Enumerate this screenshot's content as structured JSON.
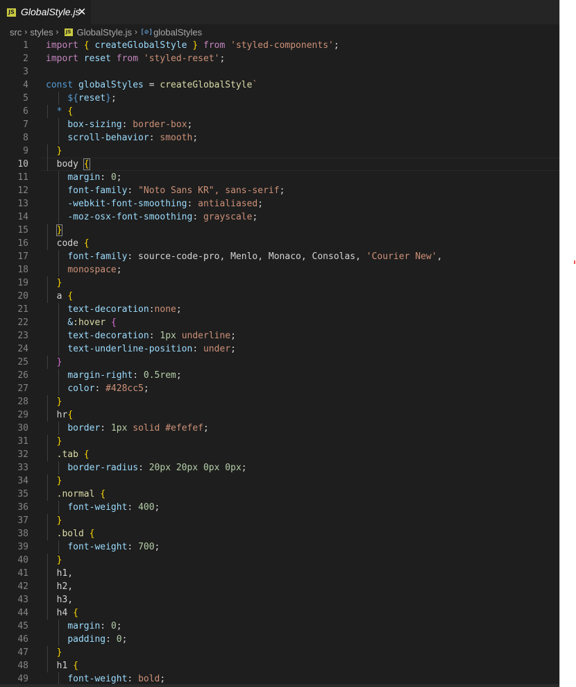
{
  "tab": {
    "title": "GlobalStyle.js",
    "close_glyph": "✕",
    "icon_label": "JS"
  },
  "breadcrumb": {
    "items": [
      "src",
      "styles",
      "GlobalStyle.js",
      "globalStyles"
    ],
    "separator": "›",
    "file_icon_label": "JS",
    "symbol_icon": "[⊘]"
  },
  "editor": {
    "active_line": 10,
    "lines": [
      {
        "n": "1",
        "g": 0,
        "t": [
          [
            "import ",
            "k"
          ],
          [
            "{ ",
            "p"
          ],
          [
            "createGlobalStyle",
            "v"
          ],
          [
            " } ",
            "p"
          ],
          [
            "from ",
            "k"
          ],
          [
            "'styled-components'",
            "s"
          ],
          [
            ";",
            ""
          ]
        ]
      },
      {
        "n": "2",
        "g": 0,
        "t": [
          [
            "import ",
            "k"
          ],
          [
            "reset ",
            "v"
          ],
          [
            "from ",
            "k"
          ],
          [
            "'styled-reset'",
            "s"
          ],
          [
            ";",
            ""
          ]
        ]
      },
      {
        "n": "3",
        "g": 0,
        "t": []
      },
      {
        "n": "4",
        "g": 0,
        "t": [
          [
            "const ",
            "kw"
          ],
          [
            "globalStyles ",
            "v"
          ],
          [
            "= ",
            ""
          ],
          [
            "createGlobalStyle",
            "f"
          ],
          [
            "`",
            "s"
          ]
        ]
      },
      {
        "n": "5",
        "g": 2,
        "t": [
          [
            "    ",
            ""
          ],
          [
            "${",
            "kw"
          ],
          [
            "reset",
            "v"
          ],
          [
            "}",
            "kw"
          ],
          [
            ";",
            ""
          ]
        ]
      },
      {
        "n": "6",
        "g": 1,
        "t": [
          [
            "  ",
            ""
          ],
          [
            "*",
            "kw"
          ],
          [
            " ",
            ""
          ],
          [
            "{",
            "p"
          ]
        ]
      },
      {
        "n": "7",
        "g": 2,
        "t": [
          [
            "    ",
            ""
          ],
          [
            "box-sizing",
            "v"
          ],
          [
            ": ",
            ""
          ],
          [
            "border-box",
            "s"
          ],
          [
            ";",
            ""
          ]
        ]
      },
      {
        "n": "8",
        "g": 2,
        "t": [
          [
            "    ",
            ""
          ],
          [
            "scroll-behavior",
            "v"
          ],
          [
            ": ",
            ""
          ],
          [
            "smooth",
            "s"
          ],
          [
            ";",
            ""
          ]
        ]
      },
      {
        "n": "9",
        "g": 1,
        "t": [
          [
            "  ",
            ""
          ],
          [
            "}",
            "p"
          ]
        ]
      },
      {
        "n": "10",
        "g": 1,
        "t": [
          [
            "  ",
            ""
          ],
          [
            "body ",
            ""
          ],
          [
            "{",
            "p b"
          ]
        ]
      },
      {
        "n": "11",
        "g": 2,
        "t": [
          [
            "    ",
            ""
          ],
          [
            "margin",
            "v"
          ],
          [
            ": ",
            ""
          ],
          [
            "0",
            "n"
          ],
          [
            ";",
            ""
          ]
        ]
      },
      {
        "n": "12",
        "g": 2,
        "t": [
          [
            "    ",
            ""
          ],
          [
            "font-family",
            "v"
          ],
          [
            ": ",
            ""
          ],
          [
            "\"Noto Sans KR\", sans-serif",
            "s"
          ],
          [
            ";",
            ""
          ]
        ]
      },
      {
        "n": "13",
        "g": 2,
        "t": [
          [
            "    ",
            ""
          ],
          [
            "-webkit-font-smoothing",
            "v"
          ],
          [
            ": ",
            ""
          ],
          [
            "antialiased",
            "s"
          ],
          [
            ";",
            ""
          ]
        ]
      },
      {
        "n": "14",
        "g": 2,
        "t": [
          [
            "    ",
            ""
          ],
          [
            "-moz-osx-font-smoothing",
            "v"
          ],
          [
            ": ",
            ""
          ],
          [
            "grayscale",
            "s"
          ],
          [
            ";",
            ""
          ]
        ]
      },
      {
        "n": "15",
        "g": 1,
        "t": [
          [
            "  ",
            ""
          ],
          [
            "}",
            "p b"
          ]
        ]
      },
      {
        "n": "16",
        "g": 1,
        "t": [
          [
            "  ",
            ""
          ],
          [
            "code ",
            ""
          ],
          [
            "{",
            "p"
          ]
        ]
      },
      {
        "n": "17",
        "g": 2,
        "t": [
          [
            "    ",
            ""
          ],
          [
            "font-family",
            "v"
          ],
          [
            ": source-code-pro, Menlo, Monaco, Consolas, ",
            ""
          ],
          [
            "'Courier New'",
            "s"
          ],
          [
            ",",
            ""
          ]
        ]
      },
      {
        "n": "18",
        "g": 2,
        "t": [
          [
            "    ",
            ""
          ],
          [
            "monospace",
            "s"
          ],
          [
            ";",
            ""
          ]
        ]
      },
      {
        "n": "19",
        "g": 1,
        "t": [
          [
            "  ",
            ""
          ],
          [
            "}",
            "p"
          ]
        ]
      },
      {
        "n": "20",
        "g": 1,
        "t": [
          [
            "  ",
            ""
          ],
          [
            "a ",
            ""
          ],
          [
            "{",
            "p"
          ]
        ]
      },
      {
        "n": "21",
        "g": 2,
        "t": [
          [
            "    ",
            ""
          ],
          [
            "text-decoration",
            "v"
          ],
          [
            ":",
            ""
          ],
          [
            "none",
            "s"
          ],
          [
            ";",
            ""
          ]
        ]
      },
      {
        "n": "22",
        "g": 2,
        "t": [
          [
            "    ",
            ""
          ],
          [
            "&",
            "v"
          ],
          [
            ":hover ",
            "f"
          ],
          [
            "{",
            "pb"
          ]
        ]
      },
      {
        "n": "23",
        "g": 2,
        "t": [
          [
            "    ",
            ""
          ],
          [
            "text-decoration",
            "v"
          ],
          [
            ": ",
            ""
          ],
          [
            "1px ",
            "n"
          ],
          [
            "underline",
            "s"
          ],
          [
            ";",
            ""
          ]
        ]
      },
      {
        "n": "24",
        "g": 2,
        "t": [
          [
            "    ",
            ""
          ],
          [
            "text-underline-position",
            "v"
          ],
          [
            ": ",
            ""
          ],
          [
            "under",
            "s"
          ],
          [
            ";",
            ""
          ]
        ]
      },
      {
        "n": "25",
        "g": 1,
        "t": [
          [
            "  ",
            ""
          ],
          [
            "}",
            "pb"
          ]
        ]
      },
      {
        "n": "26",
        "g": 2,
        "t": [
          [
            "    ",
            ""
          ],
          [
            "margin-right",
            "v"
          ],
          [
            ": ",
            ""
          ],
          [
            "0.5rem",
            "n"
          ],
          [
            ";",
            ""
          ]
        ]
      },
      {
        "n": "27",
        "g": 2,
        "t": [
          [
            "    ",
            ""
          ],
          [
            "color",
            "v"
          ],
          [
            ": ",
            ""
          ],
          [
            "#428cc5",
            "s"
          ],
          [
            ";",
            ""
          ]
        ]
      },
      {
        "n": "28",
        "g": 1,
        "t": [
          [
            "  ",
            ""
          ],
          [
            "}",
            "p"
          ]
        ]
      },
      {
        "n": "29",
        "g": 1,
        "t": [
          [
            "  ",
            ""
          ],
          [
            "hr",
            ""
          ],
          [
            "{",
            "p"
          ]
        ]
      },
      {
        "n": "30",
        "g": 2,
        "t": [
          [
            "    ",
            ""
          ],
          [
            "border",
            "v"
          ],
          [
            ": ",
            ""
          ],
          [
            "1px ",
            "n"
          ],
          [
            "solid ",
            "s"
          ],
          [
            "#efefef",
            "s"
          ],
          [
            ";",
            ""
          ]
        ]
      },
      {
        "n": "31",
        "g": 1,
        "t": [
          [
            "  ",
            ""
          ],
          [
            "}",
            "p"
          ]
        ]
      },
      {
        "n": "32",
        "g": 1,
        "t": [
          [
            "  ",
            ""
          ],
          [
            ".tab ",
            "f"
          ],
          [
            "{",
            "p"
          ]
        ]
      },
      {
        "n": "33",
        "g": 2,
        "t": [
          [
            "    ",
            ""
          ],
          [
            "border-radius",
            "v"
          ],
          [
            ": ",
            ""
          ],
          [
            "20px 20px 0px 0px",
            "n"
          ],
          [
            ";",
            ""
          ]
        ]
      },
      {
        "n": "34",
        "g": 1,
        "t": [
          [
            "  ",
            ""
          ],
          [
            "}",
            "p"
          ]
        ]
      },
      {
        "n": "35",
        "g": 1,
        "t": [
          [
            "  ",
            ""
          ],
          [
            ".normal ",
            "f"
          ],
          [
            "{",
            "p"
          ]
        ]
      },
      {
        "n": "36",
        "g": 2,
        "t": [
          [
            "    ",
            ""
          ],
          [
            "font-weight",
            "v"
          ],
          [
            ": ",
            ""
          ],
          [
            "400",
            "n"
          ],
          [
            ";",
            ""
          ]
        ]
      },
      {
        "n": "37",
        "g": 1,
        "t": [
          [
            "  ",
            ""
          ],
          [
            "}",
            "p"
          ]
        ]
      },
      {
        "n": "38",
        "g": 1,
        "t": [
          [
            "  ",
            ""
          ],
          [
            ".bold ",
            "f"
          ],
          [
            "{",
            "p"
          ]
        ]
      },
      {
        "n": "39",
        "g": 2,
        "t": [
          [
            "    ",
            ""
          ],
          [
            "font-weight",
            "v"
          ],
          [
            ": ",
            ""
          ],
          [
            "700",
            "n"
          ],
          [
            ";",
            ""
          ]
        ]
      },
      {
        "n": "40",
        "g": 1,
        "t": [
          [
            "  ",
            ""
          ],
          [
            "}",
            "p"
          ]
        ]
      },
      {
        "n": "41",
        "g": 1,
        "t": [
          [
            "  ",
            ""
          ],
          [
            "h1,",
            ""
          ]
        ]
      },
      {
        "n": "42",
        "g": 1,
        "t": [
          [
            "  ",
            ""
          ],
          [
            "h2,",
            ""
          ]
        ]
      },
      {
        "n": "43",
        "g": 1,
        "t": [
          [
            "  ",
            ""
          ],
          [
            "h3,",
            ""
          ]
        ]
      },
      {
        "n": "44",
        "g": 1,
        "t": [
          [
            "  ",
            ""
          ],
          [
            "h4 ",
            ""
          ],
          [
            "{",
            "p"
          ]
        ]
      },
      {
        "n": "45",
        "g": 2,
        "t": [
          [
            "    ",
            ""
          ],
          [
            "margin",
            "v"
          ],
          [
            ": ",
            ""
          ],
          [
            "0",
            "n"
          ],
          [
            ";",
            ""
          ]
        ]
      },
      {
        "n": "46",
        "g": 2,
        "t": [
          [
            "    ",
            ""
          ],
          [
            "padding",
            "v"
          ],
          [
            ": ",
            ""
          ],
          [
            "0",
            "n"
          ],
          [
            ";",
            ""
          ]
        ]
      },
      {
        "n": "47",
        "g": 1,
        "t": [
          [
            "  ",
            ""
          ],
          [
            "}",
            "p"
          ]
        ]
      },
      {
        "n": "48",
        "g": 1,
        "t": [
          [
            "  ",
            ""
          ],
          [
            "h1 ",
            ""
          ],
          [
            "{",
            "p"
          ]
        ]
      },
      {
        "n": "49",
        "g": 2,
        "t": [
          [
            "    ",
            ""
          ],
          [
            "font-weight",
            "v"
          ],
          [
            ": ",
            ""
          ],
          [
            "bold",
            "s"
          ],
          [
            ";",
            ""
          ]
        ]
      }
    ]
  },
  "colors": {
    "editor_bg": "#1e1e1e",
    "tabbar_bg": "#252526",
    "keyword": "#c586c0",
    "string": "#ce9178",
    "function": "#dcdcaa",
    "variable": "#9cdcfe",
    "bracket": "#ffd700",
    "number": "#b5cea8"
  }
}
